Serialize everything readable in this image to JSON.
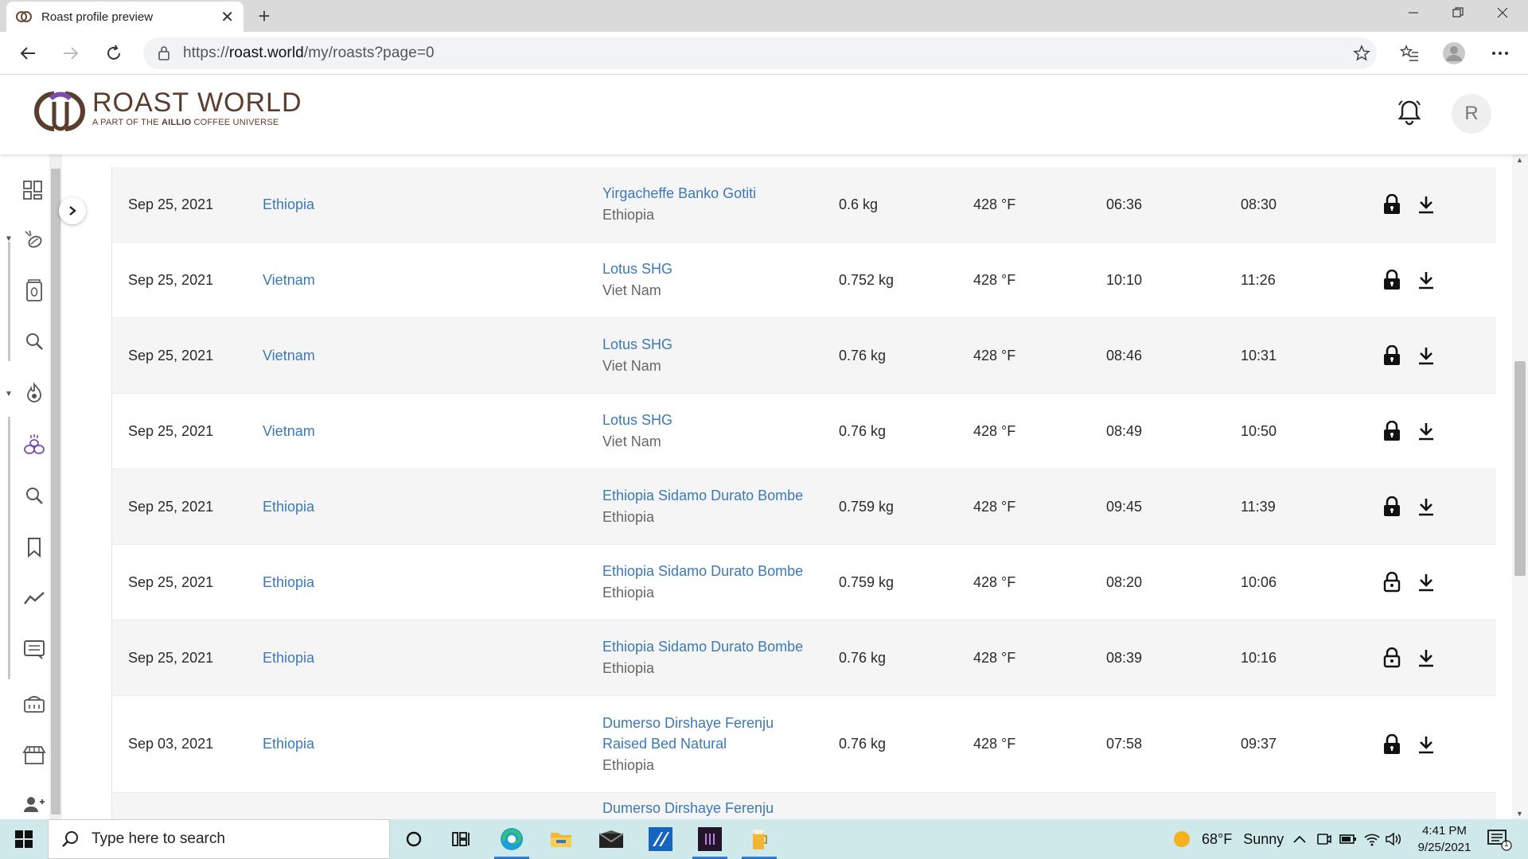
{
  "browser": {
    "tab_title": "Roast profile preview",
    "url_prefix": "https://",
    "url_host": "roast.world",
    "url_path": "/my/roasts?page=0"
  },
  "app": {
    "brand_name": "ROAST WORLD",
    "tagline_pre": "A PART OF THE ",
    "tagline_brand": "AILLIO",
    "tagline_post": " COFFEE UNIVERSE",
    "avatar_initial": "R",
    "accent_color": "#3b79b8",
    "brand_color": "#5b3d2e"
  },
  "roasts": [
    {
      "date": "Sep 25, 2021",
      "country": "Ethiopia",
      "bean_name": "Yirgacheffe Banko Gotiti",
      "bean_origin": "Ethiopia",
      "weight": "0.6 kg",
      "temp": "428 °F",
      "time1": "06:36",
      "time2": "08:30",
      "lock": "locked"
    },
    {
      "date": "Sep 25, 2021",
      "country": "Vietnam",
      "bean_name": "Lotus SHG",
      "bean_origin": "Viet Nam",
      "weight": "0.752 kg",
      "temp": "428 °F",
      "time1": "10:10",
      "time2": "11:26",
      "lock": "locked"
    },
    {
      "date": "Sep 25, 2021",
      "country": "Vietnam",
      "bean_name": "Lotus SHG",
      "bean_origin": "Viet Nam",
      "weight": "0.76 kg",
      "temp": "428 °F",
      "time1": "08:46",
      "time2": "10:31",
      "lock": "locked"
    },
    {
      "date": "Sep 25, 2021",
      "country": "Vietnam",
      "bean_name": "Lotus SHG",
      "bean_origin": "Viet Nam",
      "weight": "0.76 kg",
      "temp": "428 °F",
      "time1": "08:49",
      "time2": "10:50",
      "lock": "locked"
    },
    {
      "date": "Sep 25, 2021",
      "country": "Ethiopia",
      "bean_name": "Ethiopia Sidamo Durato Bombe",
      "bean_origin": "Ethiopia",
      "weight": "0.759 kg",
      "temp": "428 °F",
      "time1": "09:45",
      "time2": "11:39",
      "lock": "locked"
    },
    {
      "date": "Sep 25, 2021",
      "country": "Ethiopia",
      "bean_name": "Ethiopia Sidamo Durato Bombe",
      "bean_origin": "Ethiopia",
      "weight": "0.759 kg",
      "temp": "428 °F",
      "time1": "08:20",
      "time2": "10:06",
      "lock": "unlocked"
    },
    {
      "date": "Sep 25, 2021",
      "country": "Ethiopia",
      "bean_name": "Ethiopia Sidamo Durato Bombe",
      "bean_origin": "Ethiopia",
      "weight": "0.76 kg",
      "temp": "428 °F",
      "time1": "08:39",
      "time2": "10:16",
      "lock": "unlocked"
    },
    {
      "date": "Sep 03, 2021",
      "country": "Ethiopia",
      "bean_name": "Dumerso Dirshaye Ferenju Raised Bed Natural",
      "bean_origin": "Ethiopia",
      "weight": "0.76 kg",
      "temp": "428 °F",
      "time1": "07:58",
      "time2": "09:37",
      "lock": "locked"
    },
    {
      "date": "",
      "country": "",
      "bean_name": "Dumerso Dirshaye Ferenju",
      "bean_origin": "",
      "weight": "",
      "temp": "",
      "time1": "",
      "time2": "",
      "lock": "none"
    }
  ],
  "taskbar": {
    "search_placeholder": "Type here to search",
    "weather_temp": "68°F",
    "weather_text": "Sunny",
    "time": "4:41 PM",
    "date": "9/25/2021",
    "notification_count": "1"
  }
}
